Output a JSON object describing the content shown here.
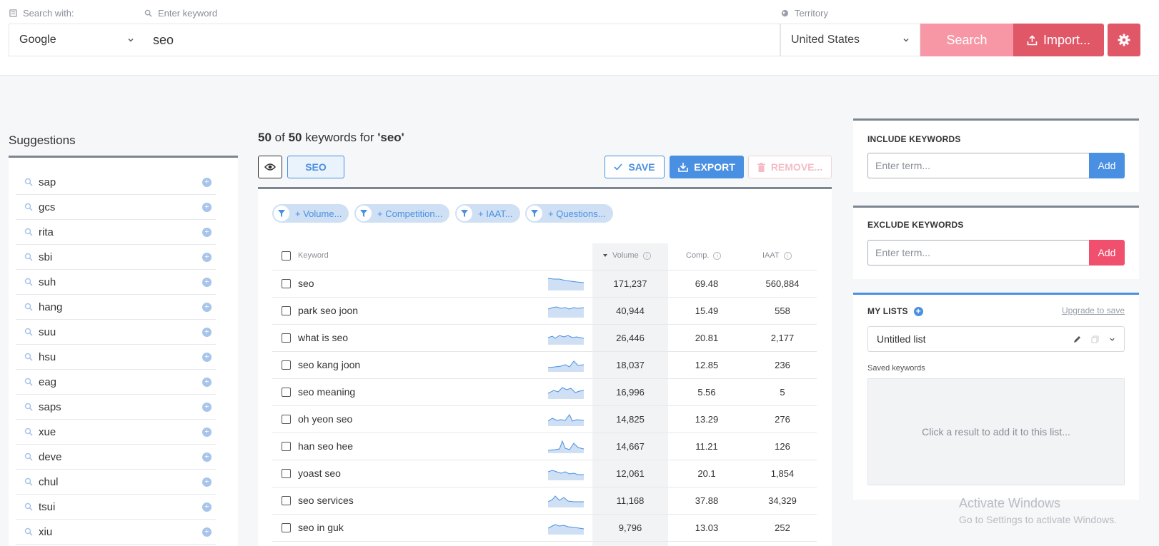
{
  "search": {
    "search_with_label": "Search with:",
    "keyword_label": "Enter keyword",
    "territory_label": "Territory",
    "engine_value": "Google",
    "keyword_value": "seo",
    "territory_value": "United States",
    "search_button": "Search",
    "import_button": "Import..."
  },
  "suggestions": {
    "title": "Suggestions",
    "items": [
      "sap",
      "gcs",
      "rita",
      "sbi",
      "suh",
      "hang",
      "suu",
      "hsu",
      "eag",
      "saps",
      "xue",
      "deve",
      "chul",
      "tsui",
      "xiu"
    ]
  },
  "results": {
    "count_shown": "50",
    "count_total": "50",
    "of_text": "of",
    "mid_text": "keywords for",
    "query_text": "'seo'",
    "tag_label": "SEO",
    "save_label": "SAVE",
    "export_label": "EXPORT",
    "remove_label": "REMOVE...",
    "filters": [
      "+ Volume...",
      "+ Competition...",
      "+ IAAT...",
      "+ Questions..."
    ],
    "columns": {
      "keyword": "Keyword",
      "volume": "Volume",
      "comp": "Comp.",
      "iaat": "IAAT"
    },
    "rows": [
      {
        "keyword": "seo",
        "volume": "171,237",
        "comp": "69.48",
        "iaat": "560,884"
      },
      {
        "keyword": "park seo joon",
        "volume": "40,944",
        "comp": "15.49",
        "iaat": "558"
      },
      {
        "keyword": "what is seo",
        "volume": "26,446",
        "comp": "20.81",
        "iaat": "2,177"
      },
      {
        "keyword": "seo kang joon",
        "volume": "18,037",
        "comp": "12.85",
        "iaat": "236"
      },
      {
        "keyword": "seo meaning",
        "volume": "16,996",
        "comp": "5.56",
        "iaat": "5"
      },
      {
        "keyword": "oh yeon seo",
        "volume": "14,825",
        "comp": "13.29",
        "iaat": "276"
      },
      {
        "keyword": "han seo hee",
        "volume": "14,667",
        "comp": "11.21",
        "iaat": "126"
      },
      {
        "keyword": "yoast seo",
        "volume": "12,061",
        "comp": "20.1",
        "iaat": "1,854"
      },
      {
        "keyword": "seo services",
        "volume": "11,168",
        "comp": "37.88",
        "iaat": "34,329"
      },
      {
        "keyword": "seo in guk",
        "volume": "9,796",
        "comp": "13.03",
        "iaat": "252"
      }
    ]
  },
  "include": {
    "title": "INCLUDE KEYWORDS",
    "placeholder": "Enter term...",
    "add": "Add"
  },
  "exclude": {
    "title": "EXCLUDE KEYWORDS",
    "placeholder": "Enter term...",
    "add": "Add"
  },
  "lists": {
    "title": "MY LISTS",
    "upgrade": "Upgrade to save",
    "selected": "Untitled list",
    "saved_label": "Saved keywords",
    "empty_text": "Click a result to add it to this list..."
  },
  "watermark": {
    "line1": "Activate Windows",
    "line2": "Go to Settings to activate Windows."
  },
  "colors": {
    "accent_blue": "#4a90e2",
    "accent_red": "#e05768",
    "search_pink": "#f797a5"
  }
}
